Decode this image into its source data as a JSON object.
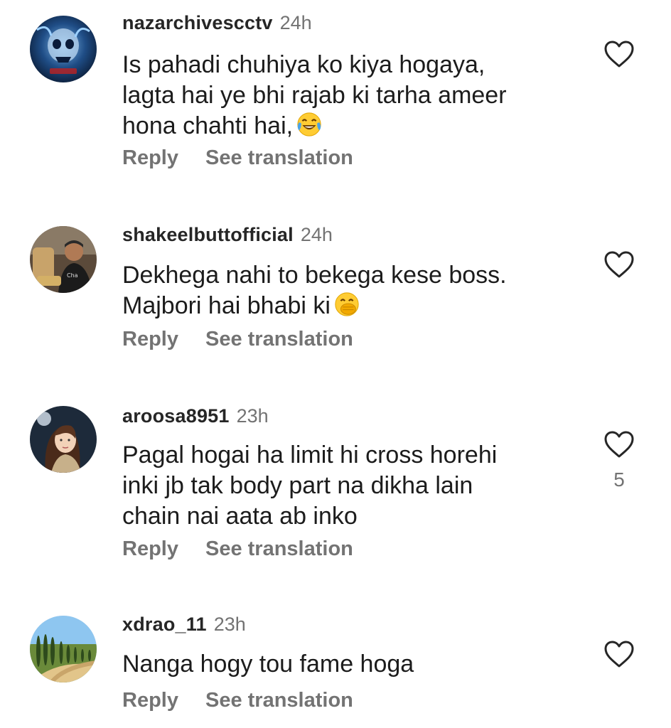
{
  "comments": [
    {
      "username": "nazarchivescctv",
      "time": "24h",
      "text": "Is pahadi chuhiya ko kiya hogaya,\nlagta hai ye bhi rajab ki tarha ameer\nhona chahti hai,",
      "emoji": "tears-of-joy-emoji",
      "reply_label": "Reply",
      "translate_label": "See translation",
      "like_count": ""
    },
    {
      "username": "shakeelbuttofficial",
      "time": "24h",
      "text": "Dekhega nahi to bekega kese boss.\nMajbori hai bhabi ki",
      "emoji": "hand-over-mouth-emoji",
      "reply_label": "Reply",
      "translate_label": "See translation",
      "like_count": ""
    },
    {
      "username": "aroosa8951",
      "time": "23h",
      "text": "Pagal hogai ha limit hi cross horehi\ninki jb tak body part na dikha lain\nchain nai aata ab inko",
      "emoji": "",
      "reply_label": "Reply",
      "translate_label": "See translation",
      "like_count": "5"
    },
    {
      "username": "xdrao_11",
      "time": "23h",
      "text": "Nanga hogy tou fame hoga",
      "emoji": "",
      "reply_label": "Reply",
      "translate_label": "See translation",
      "like_count": ""
    }
  ],
  "icons": {
    "like": "heart-outline-icon"
  },
  "colors": {
    "username": "#262626",
    "secondary_text": "#737373",
    "body_text": "#1c1c1c",
    "background": "#ffffff"
  }
}
